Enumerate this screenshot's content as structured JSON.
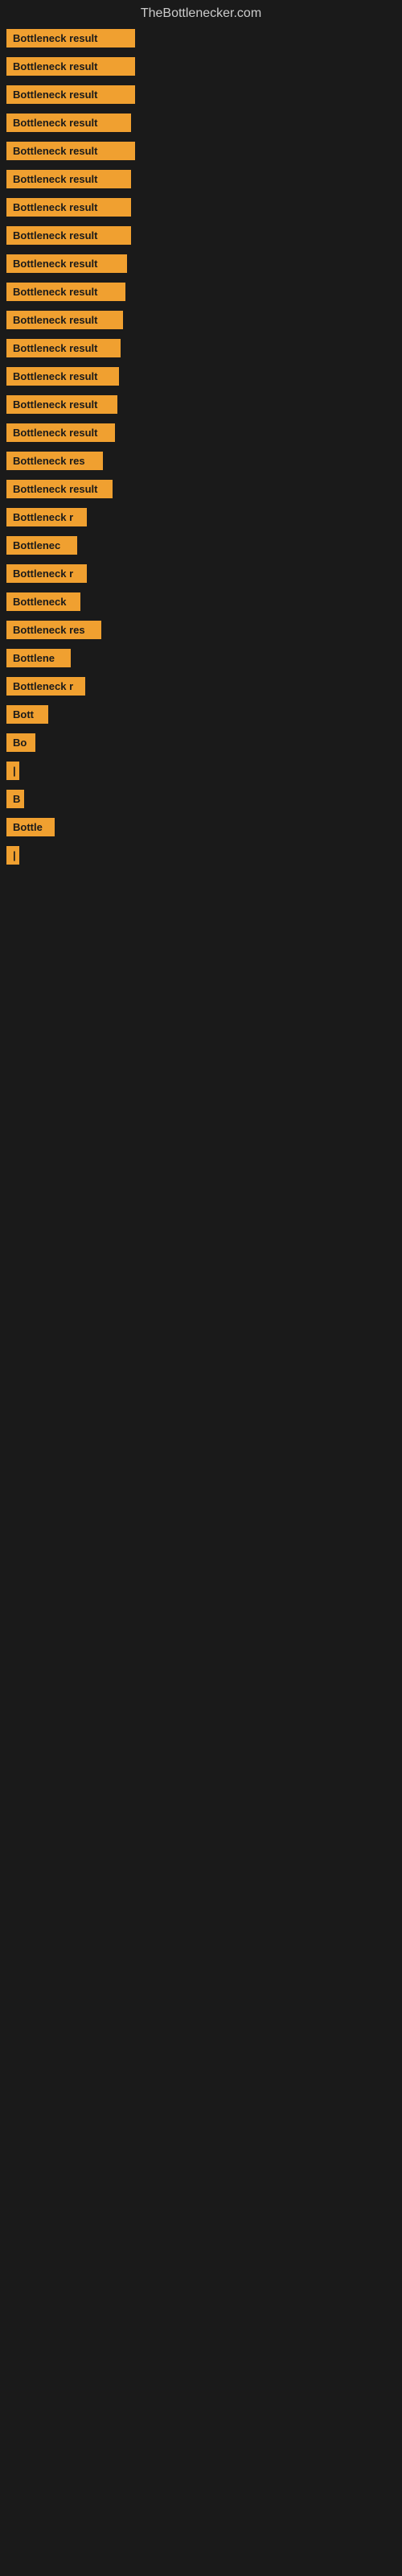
{
  "site": {
    "title": "TheBottlenecker.com"
  },
  "items": [
    {
      "label": "Bottleneck result",
      "width": 160
    },
    {
      "label": "Bottleneck result",
      "width": 160
    },
    {
      "label": "Bottleneck result",
      "width": 160
    },
    {
      "label": "Bottleneck result",
      "width": 155
    },
    {
      "label": "Bottleneck result",
      "width": 160
    },
    {
      "label": "Bottleneck result",
      "width": 155
    },
    {
      "label": "Bottleneck result",
      "width": 155
    },
    {
      "label": "Bottleneck result",
      "width": 155
    },
    {
      "label": "Bottleneck result",
      "width": 150
    },
    {
      "label": "Bottleneck result",
      "width": 148
    },
    {
      "label": "Bottleneck result",
      "width": 145
    },
    {
      "label": "Bottleneck result",
      "width": 142
    },
    {
      "label": "Bottleneck result",
      "width": 140
    },
    {
      "label": "Bottleneck result",
      "width": 138
    },
    {
      "label": "Bottleneck result",
      "width": 135
    },
    {
      "label": "Bottleneck res",
      "width": 120
    },
    {
      "label": "Bottleneck result",
      "width": 132
    },
    {
      "label": "Bottleneck r",
      "width": 100
    },
    {
      "label": "Bottlenec",
      "width": 88
    },
    {
      "label": "Bottleneck r",
      "width": 100
    },
    {
      "label": "Bottleneck",
      "width": 92
    },
    {
      "label": "Bottleneck res",
      "width": 118
    },
    {
      "label": "Bottlene",
      "width": 80
    },
    {
      "label": "Bottleneck r",
      "width": 98
    },
    {
      "label": "Bott",
      "width": 52
    },
    {
      "label": "Bo",
      "width": 36
    },
    {
      "label": "|",
      "width": 14
    },
    {
      "label": "B",
      "width": 22
    },
    {
      "label": "Bottle",
      "width": 60
    },
    {
      "label": "|",
      "width": 14
    }
  ]
}
